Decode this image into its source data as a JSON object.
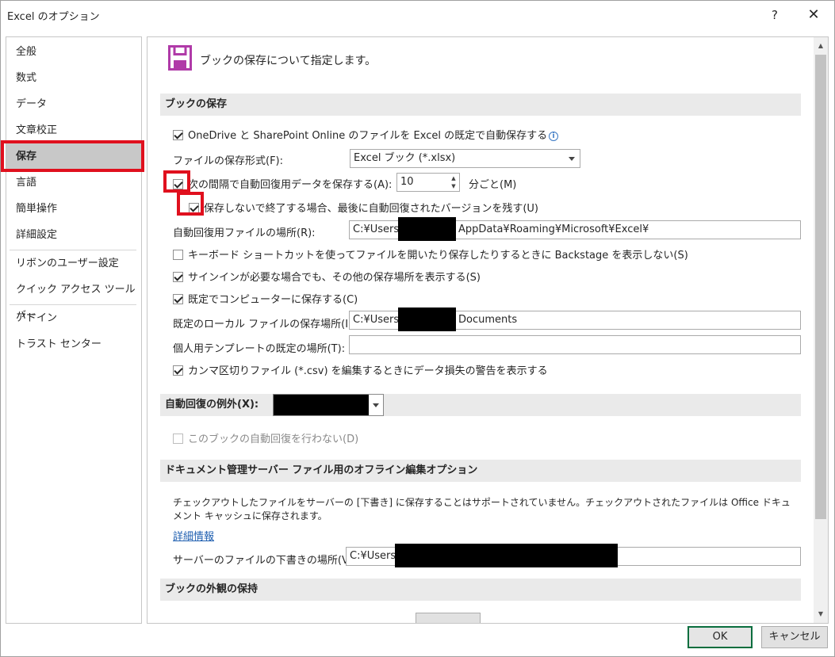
{
  "window": {
    "title": "Excel のオプション",
    "help": "?",
    "close": "✕"
  },
  "sidebar": {
    "items": [
      {
        "label": "全般"
      },
      {
        "label": "数式"
      },
      {
        "label": "データ"
      },
      {
        "label": "文章校正"
      },
      {
        "label": "保存",
        "selected": true
      },
      {
        "label": "言語"
      },
      {
        "label": "簡単操作"
      },
      {
        "label": "詳細設定"
      },
      {
        "label": "リボンのユーザー設定"
      },
      {
        "label": "クイック アクセス ツール バー"
      },
      {
        "label": "アドイン"
      },
      {
        "label": "トラスト センター"
      }
    ]
  },
  "main": {
    "header": "ブックの保存について指定します。",
    "sections": {
      "save_books": "ブックの保存",
      "autorecover_exceptions": "自動回復の例外(X):",
      "offline_editing": "ドキュメント管理サーバー ファイル用のオフライン編集オプション",
      "preserve_appearance": "ブックの外観の保持"
    },
    "options": {
      "onedrive_autosave": "OneDrive と SharePoint Online のファイルを Excel の既定で自動保存する",
      "save_format_label": "ファイルの保存形式(F):",
      "save_format_value": "Excel ブック (*.xlsx)",
      "autorecover_label": "次の間隔で自動回復用データを保存する(A):",
      "autorecover_minutes": "10",
      "minutes_suffix": "分ごと(M)",
      "keep_last_autosave": "保存しないで終了する場合、最後に自動回復されたバージョンを残す(U)",
      "autorecover_location_label": "自動回復用ファイルの場所(R):",
      "autorecover_location_prefix": "C:¥Users",
      "autorecover_location_suffix": "AppData¥Roaming¥Microsoft¥Excel¥",
      "no_backstage": "キーボード ショートカットを使ってファイルを開いたり保存したりするときに Backstage を表示しない(S)",
      "show_additional_places": "サインインが必要な場合でも、その他の保存場所を表示する(S)",
      "save_to_computer": "既定でコンピューターに保存する(C)",
      "default_local_label": "既定のローカル ファイルの保存場所(I):",
      "default_local_prefix": "C:¥Users",
      "default_local_suffix": "Documents",
      "personal_templates_label": "個人用テンプレートの既定の場所(T):",
      "personal_templates_value": "",
      "csv_warning": "カンマ区切りファイル (*.csv) を編集するときにデータ損失の警告を表示する",
      "disable_autorecover": "このブックの自動回復を行わない(D)",
      "offline_note": "チェックアウトしたファイルをサーバーの [下書き] に保存することはサポートされていません。チェックアウトされたファイルは Office ドキュメント キャッシュに保存されます。",
      "more_info": "詳細情報",
      "server_drafts_label": "サーバーのファイルの下書きの場所(V):",
      "server_drafts_prefix": "C:¥Users"
    }
  },
  "buttons": {
    "ok": "OK",
    "cancel": "キャンセル"
  },
  "colors": {
    "highlight": "#e0101e",
    "ok_border": "#0a6e3e",
    "link": "#1f5fb0"
  },
  "icons": {
    "save": "floppy-disk-icon",
    "info": "info-icon"
  }
}
